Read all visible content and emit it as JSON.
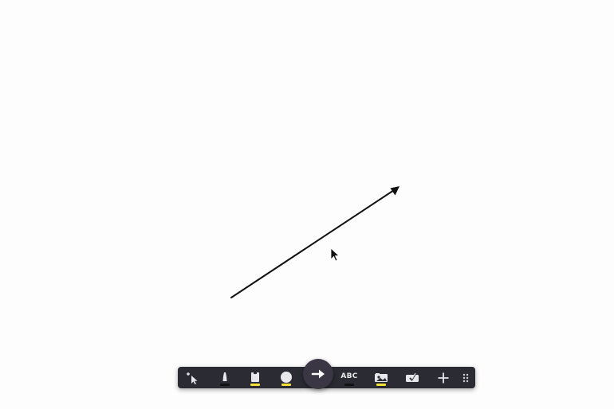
{
  "colors": {
    "canvas_bg": "#fdfdfd",
    "toolbar_bg": "#2a2b33",
    "active_tool_bg": "#3a3644",
    "icon": "#e8e8ec",
    "stroke": "#111111",
    "highlight_swatch": "#f2df3a",
    "dark_swatch": "#111111"
  },
  "canvas": {
    "drawn_object": "arrow",
    "cursor": "mouse-pointer"
  },
  "toolbar": {
    "tools": [
      {
        "id": "select",
        "icon": "select-pointer-icon",
        "active": false
      },
      {
        "id": "marker",
        "icon": "marker-icon",
        "active": false,
        "swatch": "dark"
      },
      {
        "id": "highlighter",
        "icon": "highlighter-icon",
        "active": false,
        "swatch": "highlight"
      },
      {
        "id": "shape",
        "icon": "circle-shape-icon",
        "active": false,
        "swatch": "highlight"
      },
      {
        "id": "arrow",
        "icon": "arrow-right-icon",
        "active": true
      },
      {
        "id": "text",
        "icon": "text-icon",
        "label": "ABC",
        "active": false,
        "swatch": "dark"
      },
      {
        "id": "image",
        "icon": "image-icon",
        "active": false,
        "swatch": "highlight"
      },
      {
        "id": "stamp",
        "icon": "stamp-check-icon",
        "active": false
      },
      {
        "id": "add",
        "icon": "plus-icon",
        "active": false
      },
      {
        "id": "grip",
        "icon": "drag-grip-icon",
        "active": false
      }
    ]
  }
}
